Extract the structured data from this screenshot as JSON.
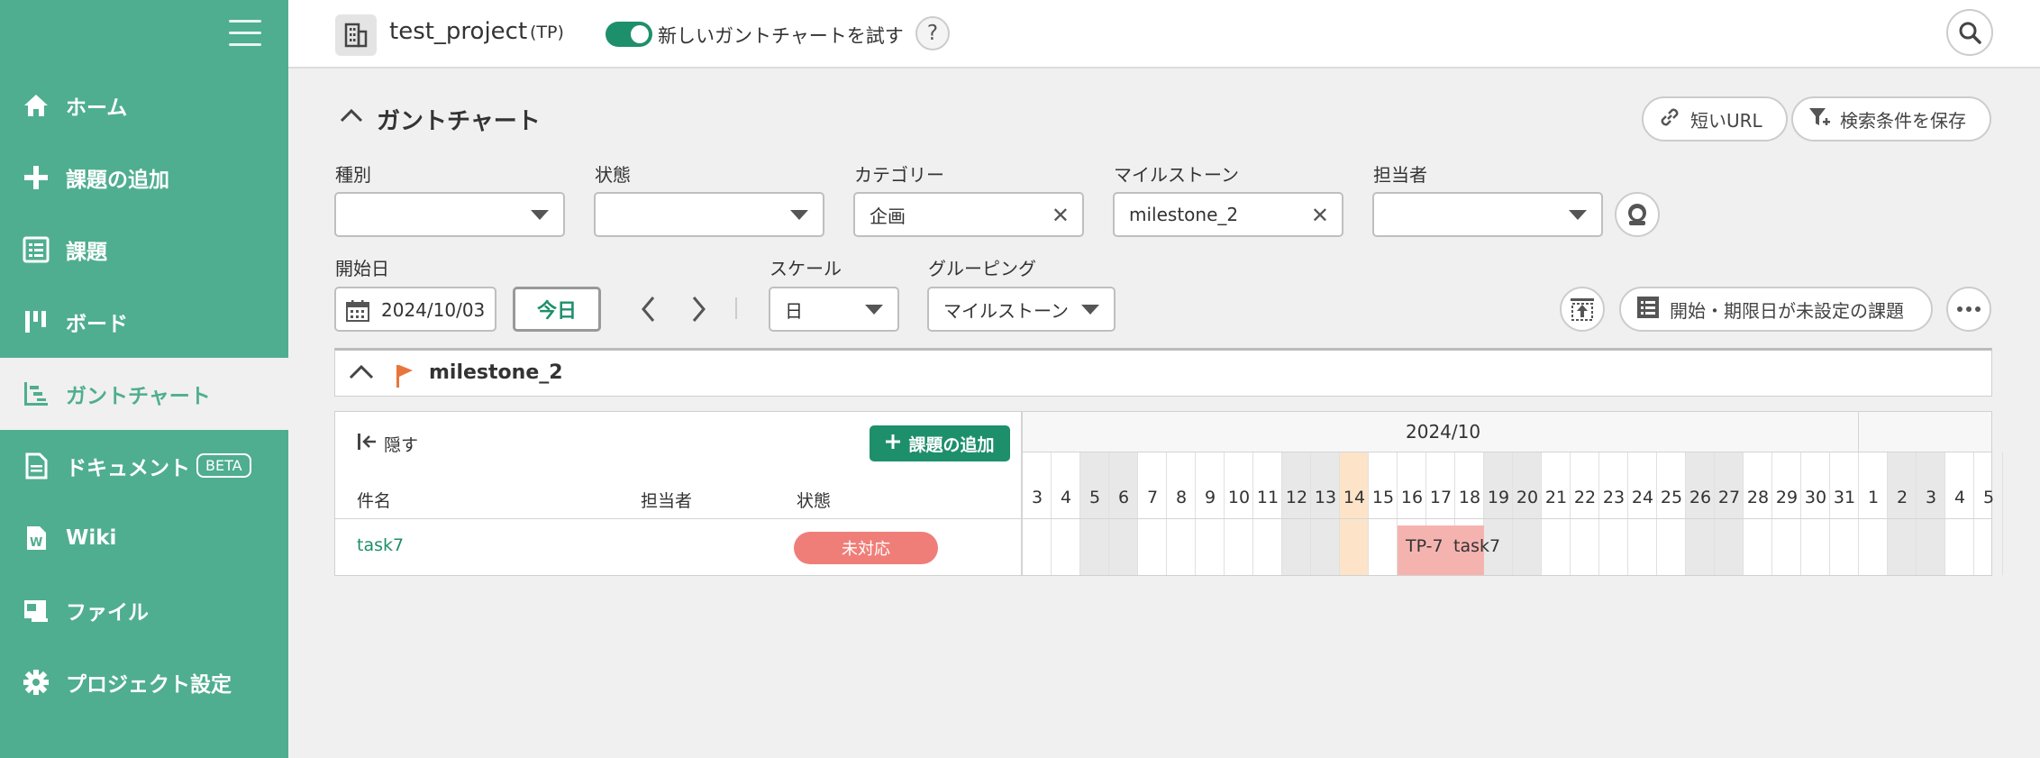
{
  "sidebar": {
    "items": [
      {
        "label": "ホーム",
        "icon": "home-icon"
      },
      {
        "label": "課題の追加",
        "icon": "plus-icon"
      },
      {
        "label": "課題",
        "icon": "list-icon"
      },
      {
        "label": "ボード",
        "icon": "board-icon"
      },
      {
        "label": "ガントチャート",
        "icon": "gantt-icon",
        "active": true
      },
      {
        "label": "ドキュメント",
        "icon": "document-icon",
        "badge": "BETA"
      },
      {
        "label": "Wiki",
        "icon": "wiki-icon"
      },
      {
        "label": "ファイル",
        "icon": "file-icon"
      },
      {
        "label": "プロジェクト設定",
        "icon": "gear-icon"
      }
    ]
  },
  "header": {
    "project_name": "test_project",
    "project_key": "(TP)",
    "toggle_label": "新しいガントチャートを試す",
    "toggle_on": true,
    "help": "?"
  },
  "main": {
    "title": "ガントチャート",
    "short_url": "短いURL",
    "save_filter": "検索条件を保存",
    "filters": {
      "type_label": "種別",
      "type_value": "",
      "status_label": "状態",
      "status_value": "",
      "category_label": "カテゴリー",
      "category_value": "企画",
      "milestone_label": "マイルストーン",
      "milestone_value": "milestone_2",
      "assignee_label": "担当者",
      "assignee_value": ""
    },
    "start_label": "開始日",
    "start_date": "2024/10/03",
    "today_button": "今日",
    "scale_label": "スケール",
    "scale_value": "日",
    "grouping_label": "グルーピング",
    "grouping_value": "マイルストーン",
    "unset_button": "開始・期限日が未設定の課題"
  },
  "milestone": {
    "name": "milestone_2"
  },
  "gantt": {
    "hide": "隠す",
    "add_issue": "課題の追加",
    "columns": {
      "subject": "件名",
      "assignee": "担当者",
      "status": "状態"
    },
    "month": "2024/10",
    "days": [
      "3",
      "4",
      "5",
      "6",
      "7",
      "8",
      "9",
      "10",
      "11",
      "12",
      "13",
      "14",
      "15",
      "16",
      "17",
      "18",
      "19",
      "20",
      "21",
      "22",
      "23",
      "24",
      "25",
      "26",
      "27",
      "28",
      "29",
      "30",
      "31",
      "1",
      "2",
      "3",
      "4",
      "5"
    ],
    "weekend_days": [
      2,
      3,
      9,
      10,
      16,
      17,
      23,
      24,
      30,
      31
    ],
    "today_index": 11,
    "rows": [
      {
        "subject": "task7",
        "assignee": "",
        "status": "未対応",
        "bar_key": "TP-7",
        "bar_summary": "task7",
        "start_index": 13,
        "end_index": 15
      }
    ]
  },
  "colors": {
    "sidebar": "#4fae8f",
    "accent": "#1e8f6b",
    "status_open": "#f07e78",
    "task_bar": "#f5b3b0",
    "today": "#fde4c8"
  }
}
